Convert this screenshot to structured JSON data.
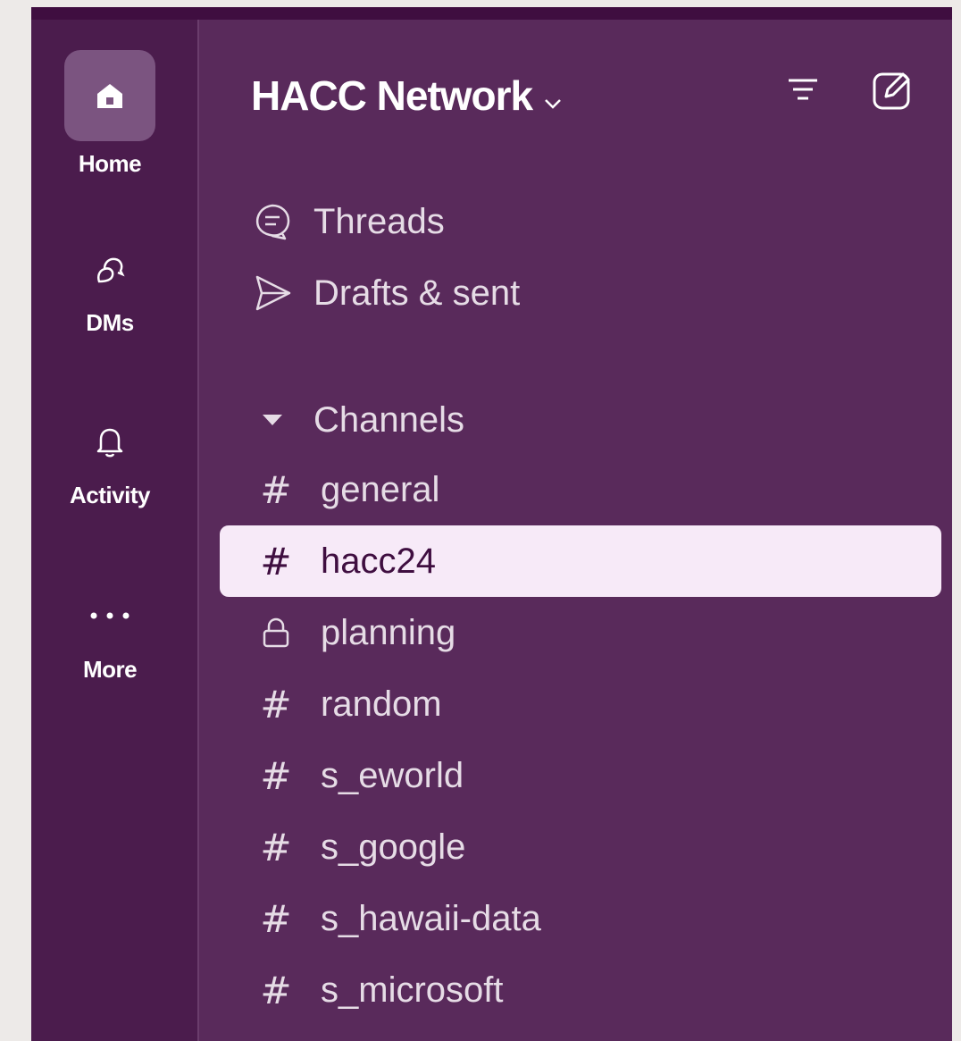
{
  "colors": {
    "sidebar_bg": "#592a5b",
    "rail_bg": "#4b1c4d",
    "selected_bg": "#f7eaf8",
    "text": "#e6dce6"
  },
  "rail": {
    "items": [
      {
        "label": "Home",
        "icon": "home-icon",
        "active": true
      },
      {
        "label": "DMs",
        "icon": "dms-icon"
      },
      {
        "label": "Activity",
        "icon": "bell-icon"
      },
      {
        "label": "More",
        "icon": "ellipsis-icon"
      }
    ]
  },
  "workspace": {
    "name": "HACC Network",
    "chevron_icon": "chevron-down-icon",
    "filter_icon": "filter-icon",
    "compose_icon": "compose-icon"
  },
  "nav": {
    "threads": "Threads",
    "drafts": "Drafts & sent"
  },
  "channels": {
    "header": "Channels",
    "items": [
      {
        "prefix": "#",
        "name": "general"
      },
      {
        "prefix": "#",
        "name": "hacc24",
        "selected": true
      },
      {
        "prefix": "lock",
        "name": "planning"
      },
      {
        "prefix": "#",
        "name": "random"
      },
      {
        "prefix": "#",
        "name": "s_eworld"
      },
      {
        "prefix": "#",
        "name": "s_google"
      },
      {
        "prefix": "#",
        "name": "s_hawaii-data"
      },
      {
        "prefix": "#",
        "name": "s_microsoft"
      }
    ]
  }
}
